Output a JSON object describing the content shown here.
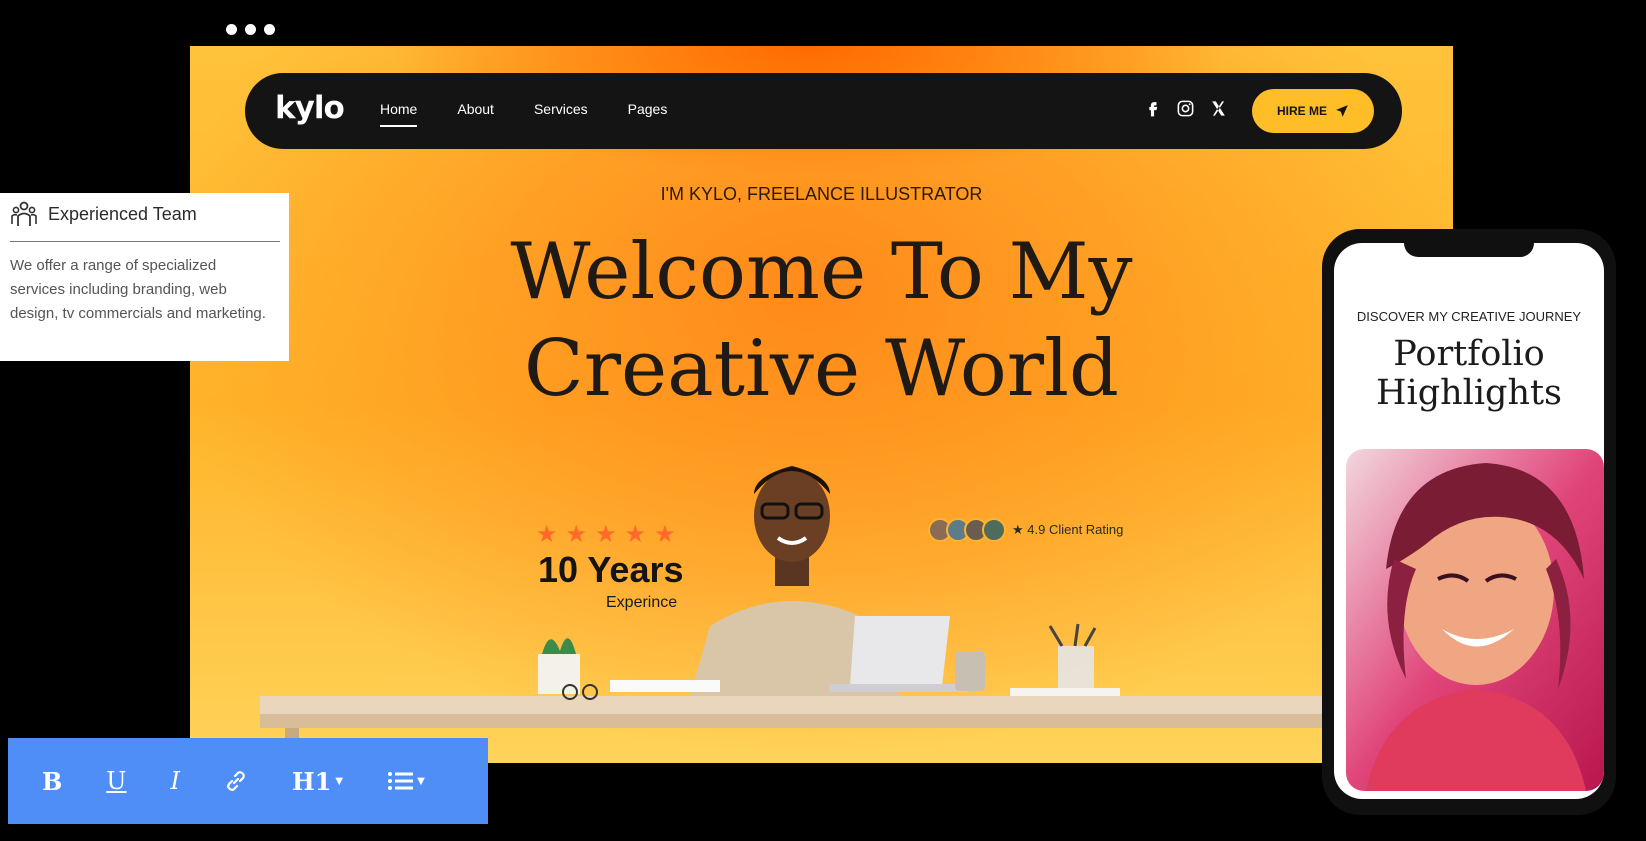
{
  "site": {
    "logo": "kylo",
    "nav": [
      "Home",
      "About",
      "Services",
      "Pages"
    ],
    "socials": [
      "facebook-icon",
      "instagram-icon",
      "x-icon"
    ],
    "hire_label": "HIRE ME",
    "eyebrow": "I'M KYLO, FREELANCE ILLUSTRATOR",
    "headline_line1": "Welcome To My",
    "headline_line2": "Creative World",
    "years": "10 Years",
    "experience": "Experince",
    "rating": "★  4.9 Client Rating",
    "colors": {
      "accent": "#ffbe27",
      "navbar": "#141414",
      "star": "#ff6a2a",
      "orange": "#ff7a00"
    }
  },
  "team_card": {
    "title": "Experienced Team",
    "text": "We offer a range of specialized services including branding, web design, tv commercials and marketing."
  },
  "toolbar": {
    "bold": "B",
    "underline": "U",
    "italic": "I",
    "heading": "H1",
    "icons": [
      "link-icon",
      "list-icon"
    ],
    "color": "#4f8ef7"
  },
  "phone": {
    "eyebrow": "DISCOVER MY CREATIVE JOURNEY",
    "title_line1": "Portfolio",
    "title_line2": "Highlights"
  }
}
